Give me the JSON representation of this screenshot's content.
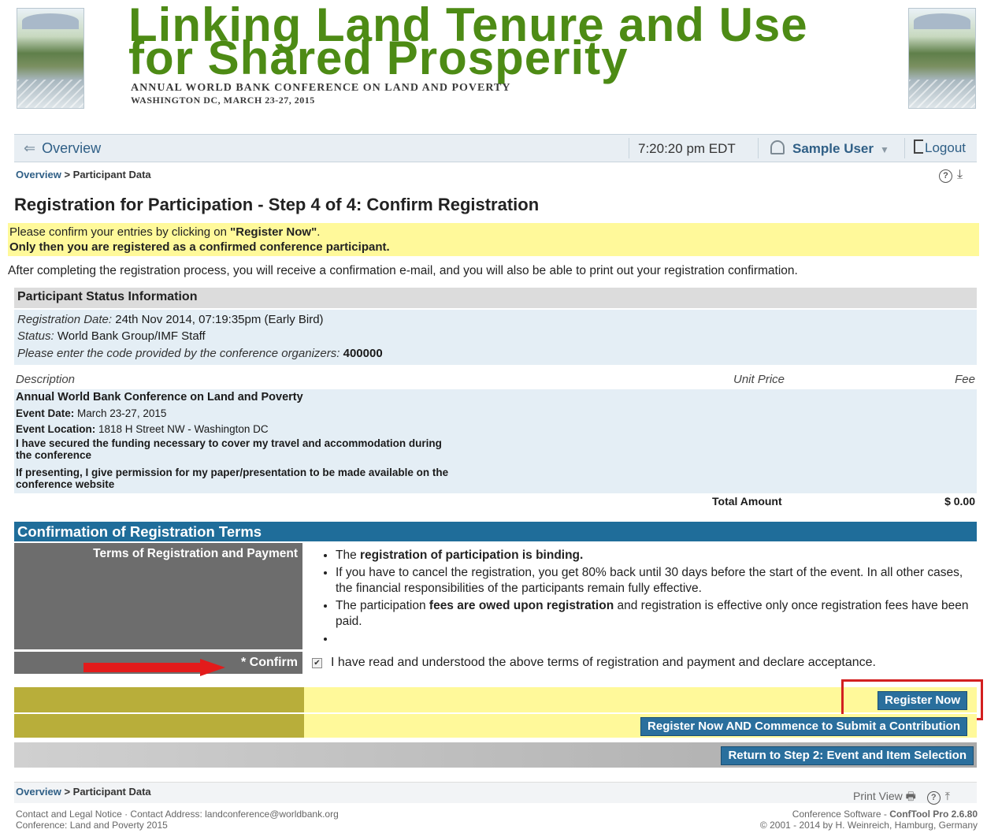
{
  "banner": {
    "title_line1": "Linking Land Tenure and Use",
    "title_line2": "for Shared Prosperity",
    "subtitle": "Annual World Bank Conference on Land and Poverty",
    "dateline": "Washington DC, March 23-27, 2015"
  },
  "nav": {
    "back_label": "Overview",
    "time": "7:20:20 pm EDT",
    "user": "Sample User",
    "logout": "Logout"
  },
  "breadcrumb": {
    "parent": "Overview",
    "sep": " > ",
    "current": "Participant Data"
  },
  "page_title": "Registration for Participation - Step 4 of 4: Confirm Registration",
  "notice": {
    "line1_pre": "Please confirm your entries by clicking on ",
    "line1_bold": "\"Register Now\"",
    "line1_post": ".",
    "line2": "Only then you are registered as a confirmed conference participant."
  },
  "info_text": "After completing the registration process, you will receive a confirmation e-mail, and you will also be able to print out your registration confirmation.",
  "status": {
    "heading": "Participant Status Information",
    "reg_date_label": "Registration Date:",
    "reg_date_value": " 24th Nov 2014, 07:19:35pm (Early Bird)",
    "status_label": "Status:",
    "status_value": " World Bank Group/IMF Staff",
    "code_label": "Please enter the code provided by the conference organizers:",
    "code_value": "400000"
  },
  "table": {
    "col_description": "Description",
    "col_unit_price": "Unit Price",
    "col_fee": "Fee",
    "item_title": "Annual World Bank Conference on Land and Poverty",
    "event_date_label": "Event Date:",
    "event_date_value": " March 23-27, 2015",
    "event_location_label": "Event Location:",
    "event_location_value": " 1818 H Street NW - Washington DC",
    "funding_line1": "I have secured the funding necessary to cover my travel and accommodation during",
    "funding_line2": "the conference",
    "permission_line1": "If presenting, I give permission for my paper/presentation to be made available on the",
    "permission_line2": "conference website",
    "total_label": "Total Amount",
    "total_value": "$ 0.00"
  },
  "confirmation": {
    "heading": "Confirmation of Registration Terms",
    "terms_label": "Terms of Registration and Payment",
    "term1_pre": "The ",
    "term1_bold": "registration of participation is binding.",
    "term2": "If you have to cancel the registration, you get 80% back until 30 days before the start of the event. In all other cases, the financial responsibilities of the participants remain fully effective.",
    "term3_pre": "The participation ",
    "term3_bold": "fees are owed upon registration",
    "term3_post": " and registration is effective only once registration fees have been paid.",
    "term4": "",
    "confirm_label": "* Confirm",
    "confirm_checked": true,
    "confirm_text": "I have read and understood the above terms of registration and payment and declare acceptance."
  },
  "buttons": {
    "register_now": "Register Now",
    "register_and_submit": "Register Now  AND  Commence to Submit a Contribution",
    "return_step2": "Return to Step 2: Event and Item Selection"
  },
  "footer": {
    "print_view": "Print View",
    "contact_line": "Contact and Legal Notice · Contact Address: landconference@worldbank.org",
    "conference_line": "Conference: Land and Poverty 2015",
    "software_pre": "Conference Software - ",
    "software_name": "ConfTool Pro 2.6.80",
    "copyright": "© 2001 - 2014 by H. Weinreich, Hamburg, Germany"
  },
  "colors": {
    "title_green": "#4d8b15",
    "header_blue": "#1f6d9a",
    "button_blue": "#2a6f9d",
    "highlight_yellow": "#fff99a",
    "annotation_red": "#d32020"
  }
}
